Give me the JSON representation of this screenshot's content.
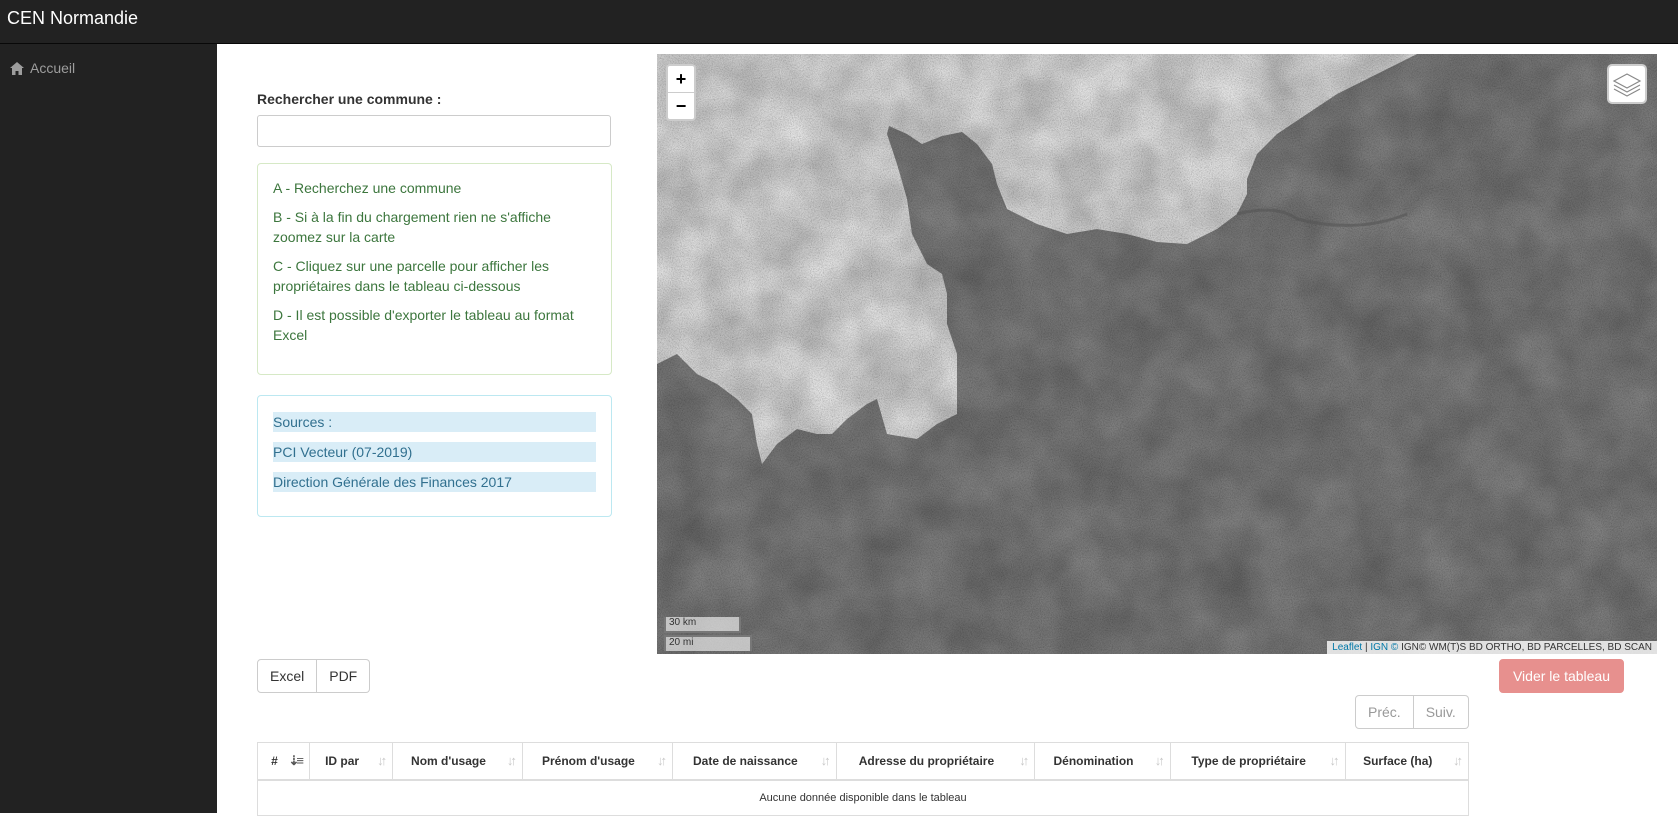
{
  "app": {
    "brand": "CEN Normandie"
  },
  "sidebar": {
    "items": [
      {
        "label": "Accueil",
        "icon": "home-icon"
      }
    ]
  },
  "search": {
    "label": "Rechercher une commune :",
    "value": "",
    "placeholder": ""
  },
  "instructions": [
    "A - Recherchez une commune",
    "B - Si à la fin du chargement rien ne s'affiche zoomez sur la carte",
    "C - Cliquez sur une parcelle pour afficher les propriétaires dans le tableau ci-dessous",
    "D - Il est possible d'exporter le tableau au format Excel"
  ],
  "sources": [
    "Sources :",
    "PCI Vecteur (07-2019)",
    "Direction Générale des Finances 2017"
  ],
  "map": {
    "zoom_in": "+",
    "zoom_out": "−",
    "scale_km": "30 km",
    "scale_mi": "20 mi",
    "attribution_leaflet": "Leaflet",
    "attribution_ign": "IGN ©",
    "attribution_rest": " IGN© WM(T)S BD ORTHO, BD PARCELLES, BD SCAN",
    "layers_icon": "layers-icon"
  },
  "export": {
    "excel": "Excel",
    "pdf": "PDF"
  },
  "clear_button": "Vider le tableau",
  "pager": {
    "prev": "Préc.",
    "next": "Suiv."
  },
  "table": {
    "columns": [
      "#",
      "ID par",
      "Nom d'usage",
      "Prénom d'usage",
      "Date de naissance",
      "Adresse du propriétaire",
      "Dénomination",
      "Type de propriétaire",
      "Surface (ha)"
    ],
    "empty": "Aucune donnée disponible dans le tableau"
  },
  "colors": {
    "topbar": "#222222",
    "success_text": "#3c763d",
    "info_text": "#31708f",
    "danger_light": "#e7908e"
  }
}
